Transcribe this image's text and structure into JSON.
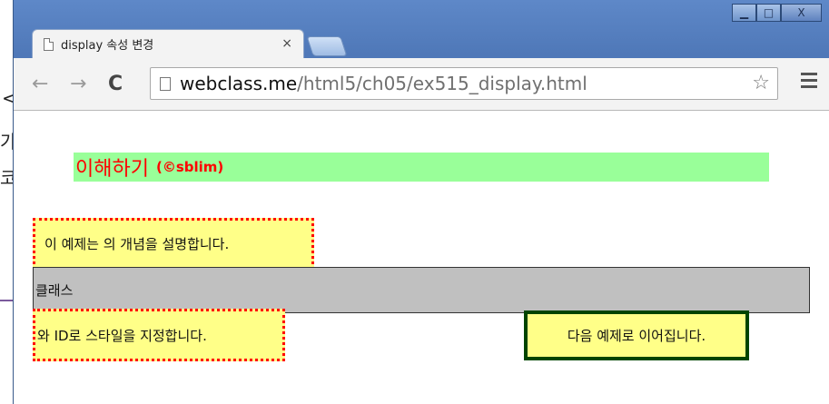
{
  "background_fragments": [
    "<",
    "가",
    "코"
  ],
  "window": {
    "controls": {
      "minimize": "▁",
      "maximize": "□",
      "close": "X"
    }
  },
  "tab": {
    "title": "display 속성 변경",
    "close": "×"
  },
  "toolbar": {
    "back": "←",
    "forward": "→",
    "reload": "C",
    "url_host": "webclass.me",
    "url_path": "/html5/ch05/ex515_display.html",
    "bookmark": "☆"
  },
  "page": {
    "heading": "이해하기",
    "heading_sub": "(©sblim)",
    "box1_text": "이 예제는 의 개념을 설명합니다.",
    "box2_text": "클래스",
    "box3_text": "와 ID로 스타일을 지정합니다.",
    "box4_text": "다음 예제로 이어집니다."
  },
  "colors": {
    "heading_bg": "#99ff99",
    "heading_text": "#ff0000",
    "box_bg": "#ffff88",
    "dotted_border": "#ff0000",
    "gray_box": "#c0c0c0",
    "solid_border": "#004400"
  }
}
